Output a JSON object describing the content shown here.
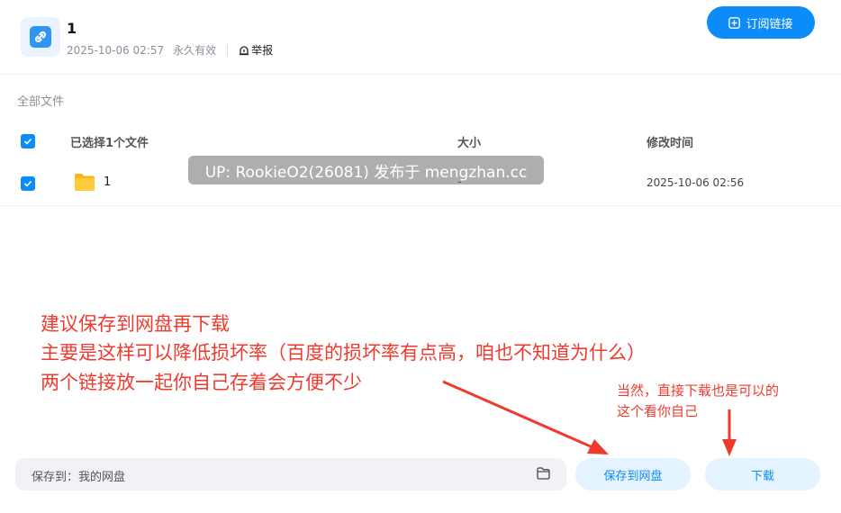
{
  "header": {
    "title": "1",
    "date": "2025-10-06 02:57",
    "validity": "永久有效",
    "report_label": "举报",
    "subscribe_label": "订阅链接"
  },
  "breadcrumb": "全部文件",
  "table": {
    "headers": {
      "name": "已选择1个文件",
      "size": "大小",
      "modified": "修改时间"
    },
    "rows": [
      {
        "name": "1",
        "size": "-",
        "modified": "2025-10-06 02:56"
      }
    ]
  },
  "watermark": "UP: RookieO2(26081) 发布于 mengzhan.cc",
  "annotations": {
    "main_lines": [
      "建议保存到网盘再下载",
      "主要是这样可以降低损坏率（百度的损坏率有点高，咱也不知道为什么）",
      "两个链接放一起你自己存着会方便不少"
    ],
    "side_lines": [
      "当然，直接下载也是可以的",
      "这个看你自己"
    ],
    "color": "#f03a2e"
  },
  "footer": {
    "save_to_label": "保存到：我的网盘",
    "save_button": "保存到网盘",
    "download_button": "下载"
  },
  "colors": {
    "accent": "#0b8cf8",
    "button_bg": "#e5f2ff"
  }
}
